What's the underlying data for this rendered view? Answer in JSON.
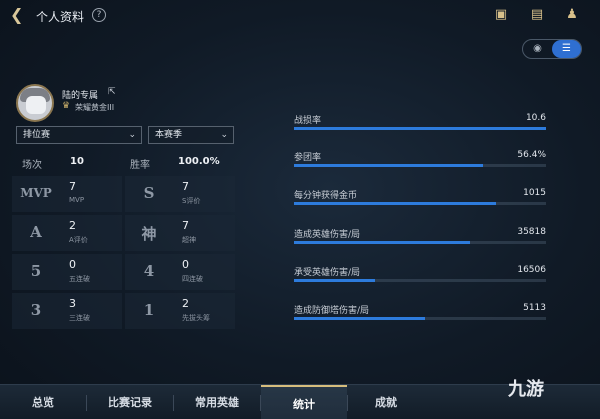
{
  "header": {
    "title": "个人资料",
    "help_glyph": "?",
    "back_icon": "back-arrow-icon",
    "right_icons": [
      "task-icon",
      "chat-icon",
      "friends-icon"
    ]
  },
  "view_toggle": {
    "options": [
      "◉",
      "☰"
    ],
    "active": 1
  },
  "profile": {
    "name": "陆的专属",
    "rank": "荣耀黄金III"
  },
  "filters": {
    "mode": "排位赛",
    "season": "本赛季"
  },
  "overall": {
    "games_label": "场次",
    "games": "10",
    "winrate_label": "胜率",
    "winrate": "100.0%"
  },
  "achievements": [
    {
      "icon": "MVP",
      "value": "7",
      "label": "MVP"
    },
    {
      "icon": "S",
      "value": "7",
      "label": "S评价"
    },
    {
      "icon": "A",
      "value": "2",
      "label": "A评价"
    },
    {
      "icon": "神",
      "value": "7",
      "label": "超神"
    },
    {
      "icon": "5",
      "value": "0",
      "label": "五连破"
    },
    {
      "icon": "4",
      "value": "0",
      "label": "四连破"
    },
    {
      "icon": "3",
      "value": "3",
      "label": "三连破"
    },
    {
      "icon": "1",
      "value": "2",
      "label": "先拔头筹"
    }
  ],
  "stats": [
    {
      "label": "战损率",
      "value": "10.6",
      "fill": 1.0
    },
    {
      "label": "参团率",
      "value": "56.4%",
      "fill": 0.75
    },
    {
      "label": "每分钟获得金币",
      "value": "1015",
      "fill": 0.8
    },
    {
      "label": "造成英雄伤害/局",
      "value": "35818",
      "fill": 0.7
    },
    {
      "label": "承受英雄伤害/局",
      "value": "16506",
      "fill": 0.32
    },
    {
      "label": "造成防御塔伤害/局",
      "value": "5113",
      "fill": 0.52
    }
  ],
  "tabs": [
    "总览",
    "比赛记录",
    "常用英雄",
    "统计",
    "成就"
  ],
  "active_tab": 3,
  "watermark": "九游",
  "colors": {
    "accent_blue": "#2d7bdc",
    "gold": "#d6bd7d"
  }
}
